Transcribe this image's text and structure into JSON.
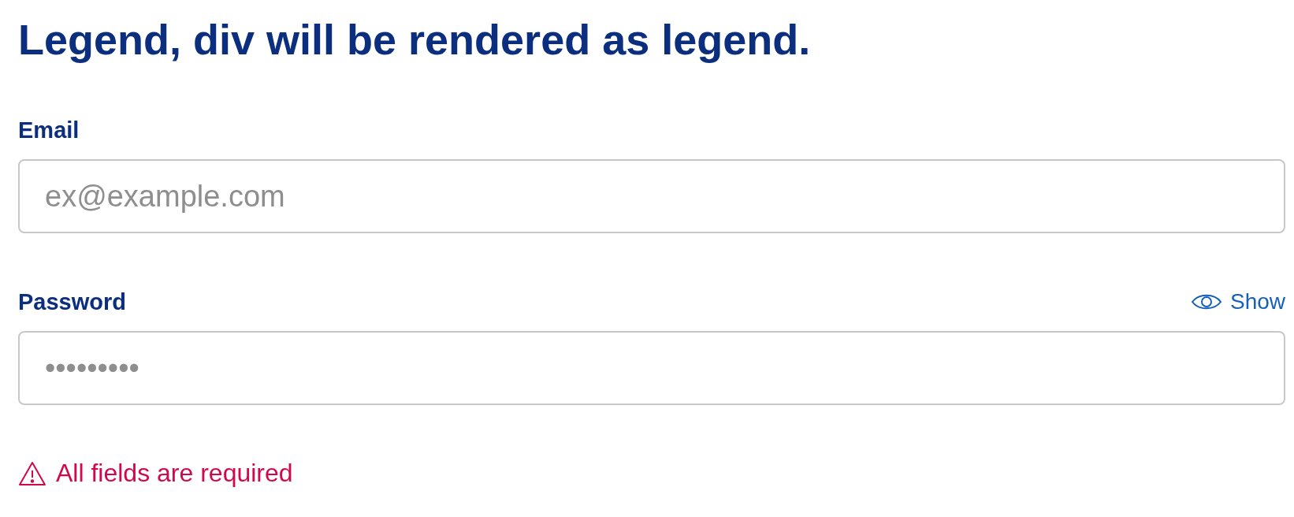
{
  "heading": "Legend, div will be rendered as legend.",
  "fields": [
    {
      "label": "Email",
      "placeholder": "ex@example.com"
    },
    {
      "label": "Password",
      "placeholder": "•••••••••",
      "toggle": "Show"
    }
  ],
  "error": "All fields are required"
}
